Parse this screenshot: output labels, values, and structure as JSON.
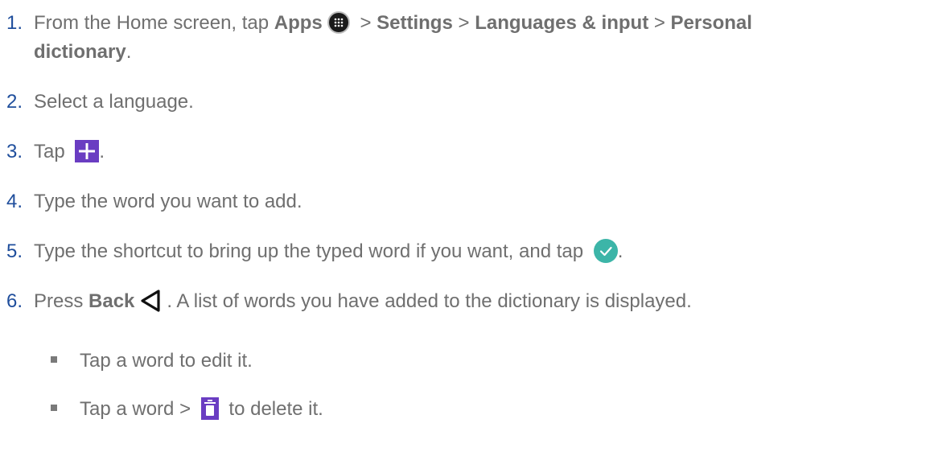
{
  "steps": [
    {
      "num": "1.",
      "parts": {
        "p1": "From the Home screen, tap ",
        "apps": "Apps",
        "sep1": " > ",
        "settings": "Settings",
        "sep2": " > ",
        "languages": "Languages & input",
        "sep3": " > ",
        "personal": "Personal",
        "dictionary": "dictionary",
        "end": "."
      }
    },
    {
      "num": "2.",
      "text": "Select a language."
    },
    {
      "num": "3.",
      "pre": "Tap ",
      "post": "."
    },
    {
      "num": "4.",
      "text": "Type the word you want to add."
    },
    {
      "num": "5.",
      "pre": "Type the shortcut to bring up the typed word if you want, and tap ",
      "post": "."
    },
    {
      "num": "6.",
      "pre": "Press ",
      "back": "Back",
      "post": ". A list of words you have added to the dictionary is displayed."
    }
  ],
  "bullets": [
    {
      "text": "Tap a word to edit it."
    },
    {
      "pre": "Tap a word > ",
      "post": " to delete it."
    }
  ],
  "icons": {
    "apps": "apps-grid-icon",
    "plus": "plus-icon",
    "check": "check-circle-icon",
    "back": "back-triangle-icon",
    "trash": "trash-icon"
  },
  "colors": {
    "number": "#1f4e9c",
    "body_text": "#6f6f6f",
    "icon_purple": "#6a3dc2",
    "icon_teal": "#3cb5a8"
  }
}
